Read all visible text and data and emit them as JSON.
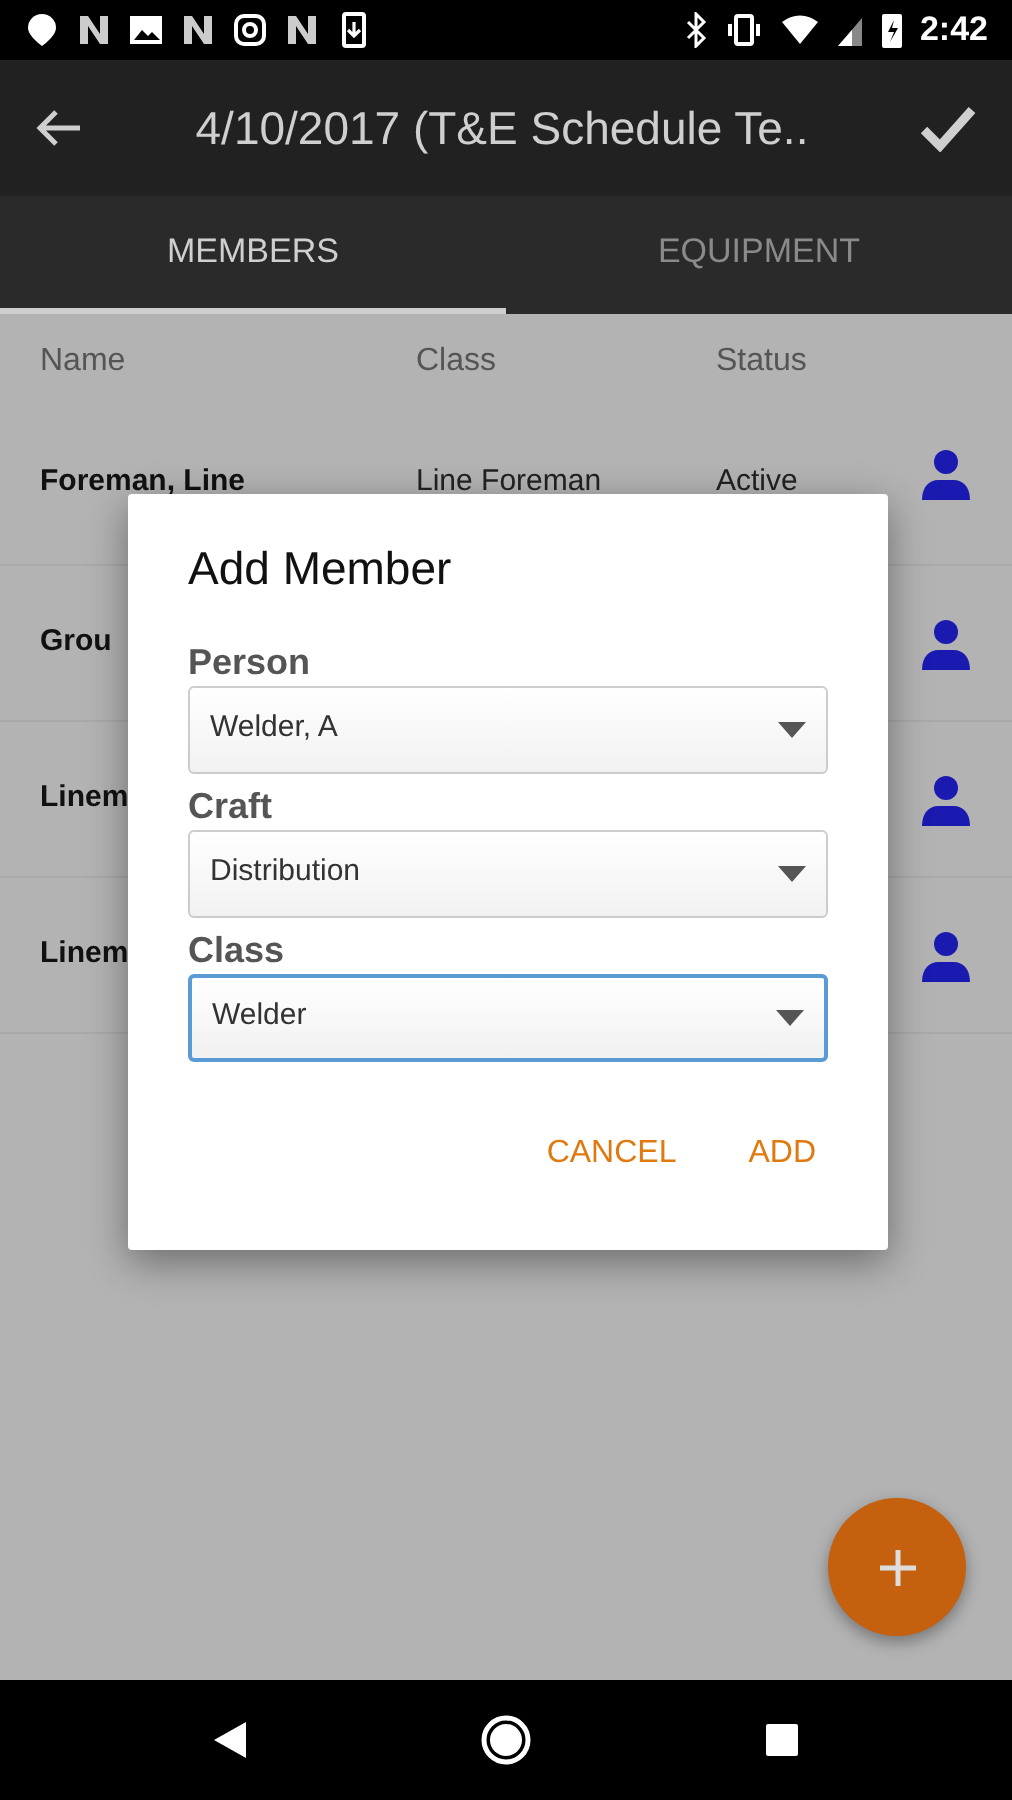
{
  "status_bar": {
    "time": "2:42"
  },
  "app_bar": {
    "title": "4/10/2017 (T&E Schedule Te.."
  },
  "tabs": [
    {
      "label": "MEMBERS",
      "selected": true
    },
    {
      "label": "EQUIPMENT",
      "selected": false
    }
  ],
  "table": {
    "columns": [
      "Name",
      "Class",
      "Status"
    ],
    "rows": [
      {
        "name": "Foreman, Line",
        "class": "Line Foreman",
        "status": "Active"
      },
      {
        "name": "Grou"
      },
      {
        "name": "Linem"
      },
      {
        "name": "Linem"
      }
    ]
  },
  "dialog": {
    "title": "Add Member",
    "fields": [
      {
        "label": "Person",
        "value": "Welder, A",
        "focused": false
      },
      {
        "label": "Craft",
        "value": "Distribution",
        "focused": false
      },
      {
        "label": "Class",
        "value": "Welder",
        "focused": true
      }
    ],
    "buttons": [
      "CANCEL",
      "ADD"
    ]
  }
}
